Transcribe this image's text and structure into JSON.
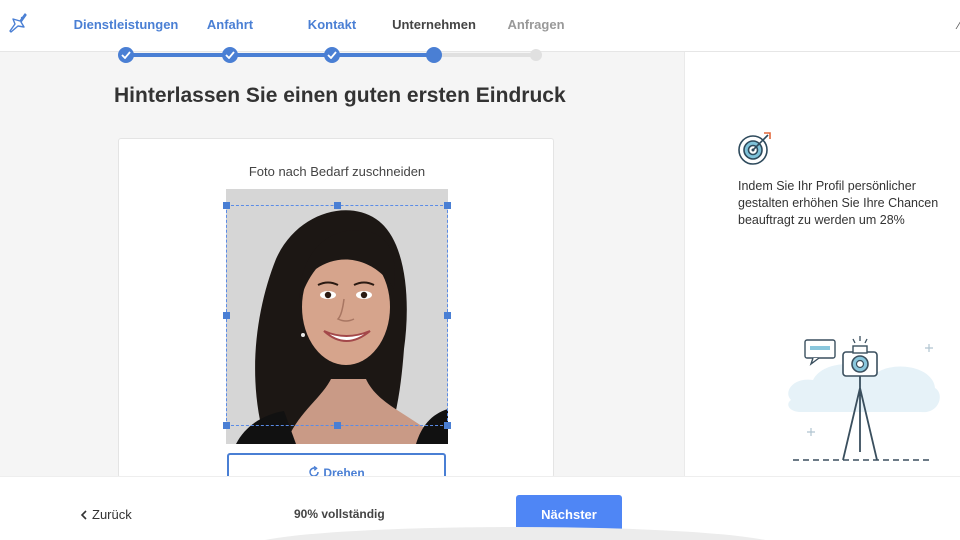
{
  "nav": {
    "steps": [
      {
        "label": "Dienstleistungen",
        "state": "done"
      },
      {
        "label": "Anfahrt",
        "state": "done"
      },
      {
        "label": "Kontakt",
        "state": "done"
      },
      {
        "label": "Unternehmen",
        "state": "current"
      },
      {
        "label": "Anfragen",
        "state": "todo"
      }
    ],
    "edge_glyph": "⁄",
    "colors": {
      "accent": "#4a7fd4",
      "inactive": "#e0e0e0"
    }
  },
  "main": {
    "headline": "Hinterlassen Sie einen guten ersten Eindruck",
    "card": {
      "title": "Foto nach Bedarf zuschneiden",
      "rotate_icon": "rotate-icon",
      "rotate_label": "Drehen"
    }
  },
  "side": {
    "icon": "target-icon",
    "text": "Indem Sie Ihr Profil persönlicher gestalten erhöhen Sie Ihre Chancen beauftragt zu werden um 28%",
    "illustration": "camera-on-tripod"
  },
  "footer": {
    "back_label": "Zurück",
    "progress_text": "90% vollständig",
    "progress": 0.9,
    "next_label": "Nächster",
    "colors": {
      "primary": "#4f86f5"
    }
  }
}
